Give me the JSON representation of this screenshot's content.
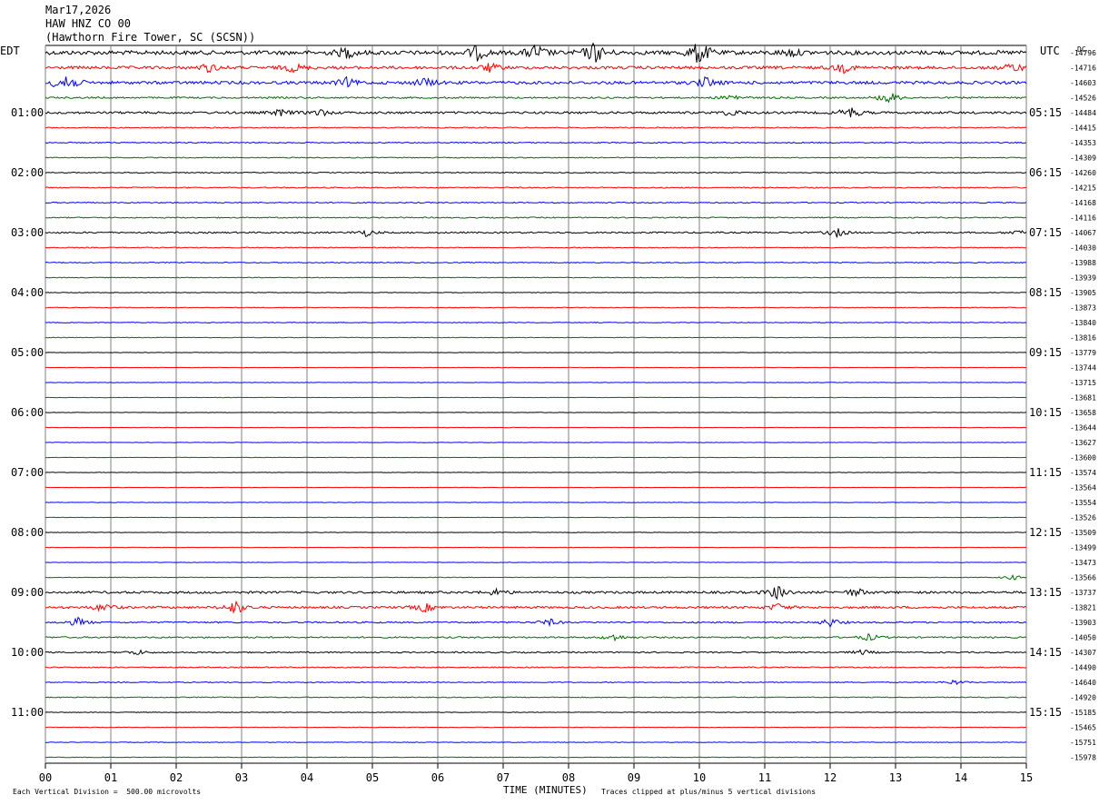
{
  "header": {
    "date": "Mar17,2026",
    "station": "HAW HNZ CO 00",
    "location": "(Hawthorn Fire Tower, SC (SCSN))",
    "left_zone": "EDT",
    "right_zone": "UTC",
    "dc_label": "DC"
  },
  "footer": {
    "scale_note": "Each Vertical Division =  500.00 microvolts",
    "x_axis_title": "TIME (MINUTES)",
    "clip_note": "Traces clipped at plus/minus 5 vertical divisions"
  },
  "colors": {
    "trace_cycle": [
      "#000000",
      "#ff0000",
      "#0000ff",
      "#007000"
    ],
    "grid": "#808080"
  },
  "chart_data": {
    "type": "line",
    "title": "HAW HNZ CO 00",
    "xlabel": "TIME (MINUTES)",
    "xlim": [
      0,
      15
    ],
    "x_ticks": [
      "00",
      "01",
      "02",
      "03",
      "04",
      "05",
      "06",
      "07",
      "08",
      "09",
      "10",
      "11",
      "12",
      "13",
      "14",
      "15"
    ],
    "left_hour_labels": [
      "01:00",
      "02:00",
      "03:00",
      "04:00",
      "05:00",
      "06:00",
      "07:00",
      "08:00",
      "09:00",
      "10:00",
      "11:00"
    ],
    "right_hour_labels": [
      "05:15",
      "06:15",
      "07:15",
      "08:15",
      "09:15",
      "10:15",
      "11:15",
      "12:15",
      "13:15",
      "14:15",
      "15:15"
    ],
    "dc_offsets": [
      "-14796",
      "-14716",
      "-14603",
      "-14526",
      "-14484",
      "-14415",
      "-14353",
      "-14309",
      "-14260",
      "-14215",
      "-14168",
      "-14116",
      "-14067",
      "-14030",
      "-13988",
      "-13939",
      "-13905",
      "-13873",
      "-13840",
      "-13816",
      "-13779",
      "-13744",
      "-13715",
      "-13681",
      "-13658",
      "-13644",
      "-13627",
      "-13600",
      "-13574",
      "-13564",
      "-13554",
      "-13526",
      "-13509",
      "-13499",
      "-13473",
      "-13566",
      "-13737",
      "-13821",
      "-13903",
      "-14050",
      "-14307",
      "-14490",
      "-14640",
      "-14920",
      "-15185",
      "-15465",
      "-15751",
      "-15978"
    ],
    "trace_activity": [
      2.2,
      1.6,
      1.6,
      0.9,
      1.2,
      0.6,
      0.6,
      0.5,
      0.5,
      0.6,
      0.6,
      0.6,
      0.8,
      0.5,
      0.5,
      0.4,
      0.3,
      0.4,
      0.4,
      0.3,
      0.2,
      0.2,
      0.2,
      0.2,
      0.2,
      0.2,
      0.2,
      0.2,
      0.2,
      0.2,
      0.2,
      0.2,
      0.2,
      0.2,
      0.2,
      0.3,
      1.2,
      1.2,
      0.8,
      0.8,
      0.7,
      0.6,
      0.5,
      0.5,
      0.3,
      0.3,
      0.3,
      0.3
    ],
    "events": [
      {
        "row": 0,
        "minute": 4.6,
        "amp": 6
      },
      {
        "row": 0,
        "minute": 6.6,
        "amp": 8
      },
      {
        "row": 0,
        "minute": 7.5,
        "amp": 9
      },
      {
        "row": 0,
        "minute": 8.4,
        "amp": 12
      },
      {
        "row": 0,
        "minute": 10.0,
        "amp": 14
      },
      {
        "row": 0,
        "minute": 11.4,
        "amp": 4
      },
      {
        "row": 1,
        "minute": 2.5,
        "amp": 5
      },
      {
        "row": 1,
        "minute": 3.8,
        "amp": 5
      },
      {
        "row": 1,
        "minute": 6.8,
        "amp": 5
      },
      {
        "row": 1,
        "minute": 12.2,
        "amp": 5
      },
      {
        "row": 1,
        "minute": 14.8,
        "amp": 5
      },
      {
        "row": 2,
        "minute": 0.3,
        "amp": 14
      },
      {
        "row": 2,
        "minute": 4.6,
        "amp": 5
      },
      {
        "row": 2,
        "minute": 5.8,
        "amp": 5
      },
      {
        "row": 2,
        "minute": 10.1,
        "amp": 6
      },
      {
        "row": 3,
        "minute": 10.5,
        "amp": 4
      },
      {
        "row": 3,
        "minute": 12.9,
        "amp": 7
      },
      {
        "row": 4,
        "minute": 3.6,
        "amp": 4
      },
      {
        "row": 4,
        "minute": 4.2,
        "amp": 4
      },
      {
        "row": 4,
        "minute": 10.5,
        "amp": 4
      },
      {
        "row": 4,
        "minute": 12.3,
        "amp": 7
      },
      {
        "row": 12,
        "minute": 4.9,
        "amp": 4
      },
      {
        "row": 12,
        "minute": 12.1,
        "amp": 5
      },
      {
        "row": 12,
        "minute": 14.9,
        "amp": 4
      },
      {
        "row": 35,
        "minute": 14.8,
        "amp": 3
      },
      {
        "row": 36,
        "minute": 6.9,
        "amp": 4
      },
      {
        "row": 36,
        "minute": 11.2,
        "amp": 8
      },
      {
        "row": 36,
        "minute": 12.4,
        "amp": 5
      },
      {
        "row": 37,
        "minute": 0.9,
        "amp": 5
      },
      {
        "row": 37,
        "minute": 2.9,
        "amp": 8
      },
      {
        "row": 37,
        "minute": 5.8,
        "amp": 5
      },
      {
        "row": 37,
        "minute": 11.2,
        "amp": 4
      },
      {
        "row": 38,
        "minute": 0.5,
        "amp": 5
      },
      {
        "row": 38,
        "minute": 7.7,
        "amp": 4
      },
      {
        "row": 38,
        "minute": 12.0,
        "amp": 5
      },
      {
        "row": 39,
        "minute": 8.7,
        "amp": 4
      },
      {
        "row": 39,
        "minute": 12.6,
        "amp": 4
      },
      {
        "row": 40,
        "minute": 1.4,
        "amp": 3
      },
      {
        "row": 40,
        "minute": 12.5,
        "amp": 3
      },
      {
        "row": 42,
        "minute": 13.9,
        "amp": 3
      }
    ]
  }
}
